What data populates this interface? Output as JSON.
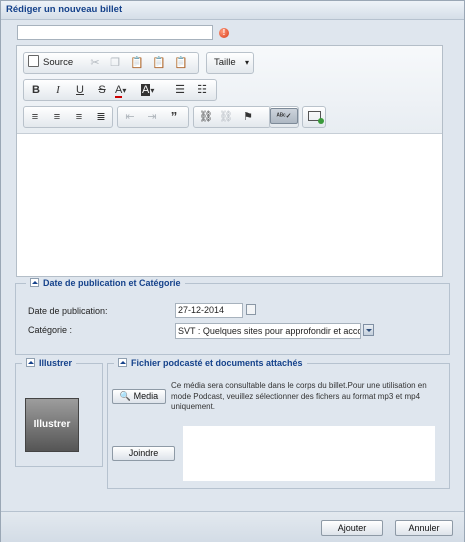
{
  "window": {
    "title": "Rédiger un nouveau billet"
  },
  "title_field": {
    "value": ""
  },
  "toolbar": {
    "source_label": "Source",
    "size_label": "Taille",
    "text_color_icon": "A",
    "bg_color_icon": "A",
    "icons": [
      "source-icon",
      "cut-icon",
      "copy-icon",
      "paste-icon",
      "paste-text-icon",
      "paste-word-icon",
      "bold-icon",
      "italic-icon",
      "underline-icon",
      "strikethrough-icon",
      "text-color-icon",
      "background-color-icon",
      "numbered-list-icon",
      "bulleted-list-icon",
      "align-left-icon",
      "align-center-icon",
      "align-right-icon",
      "justify-icon",
      "outdent-icon",
      "indent-icon",
      "blockquote-icon",
      "link-icon",
      "unlink-icon",
      "anchor-icon",
      "spellcheck-icon",
      "insert-widget-icon"
    ]
  },
  "publication": {
    "legend": "Date de publication et Catégorie",
    "date_label": "Date de publication:",
    "date_value": "27-12-2014",
    "category_label": "Catégorie :",
    "category_value": "SVT : Quelques sites pour approfondir et acco"
  },
  "illustrer": {
    "legend": "Illustrer",
    "image_label": "Illustrer"
  },
  "podcast": {
    "legend": "Fichier podcasté et documents attachés",
    "media_button": "Media",
    "media_note": "Ce média sera consultable dans le corps du billet.Pour une utilisation en mode Podcast, veuillez sélectionner des fichers au format mp3 et mp4 uniquement.",
    "attach_button": "Joindre"
  },
  "actions": {
    "add_label": "Ajouter",
    "cancel_label": "Annuler"
  },
  "colors": {
    "title_blue": "#15428b",
    "panel_bg": "#dfe6ee",
    "required_red": "#d83b1a"
  }
}
